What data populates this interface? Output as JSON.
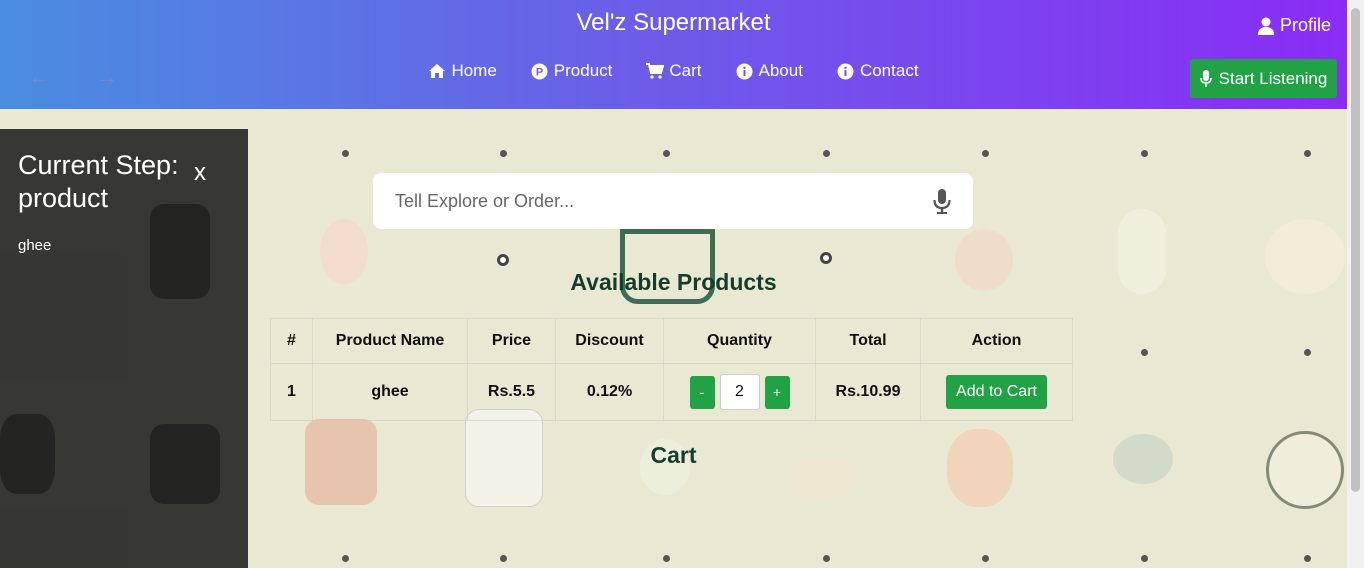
{
  "header": {
    "brand": "Vel'z Supermarket",
    "profile_label": "Profile",
    "listen_label": "Start Listening"
  },
  "nav": [
    {
      "label": "Home",
      "icon": "home-icon"
    },
    {
      "label": "Product",
      "icon": "product-icon"
    },
    {
      "label": "Cart",
      "icon": "cart-icon"
    },
    {
      "label": "About",
      "icon": "info-icon"
    },
    {
      "label": "Contact",
      "icon": "info-icon"
    }
  ],
  "side_panel": {
    "title": "Current Step: product",
    "close": "x",
    "value": "ghee"
  },
  "search": {
    "placeholder": "Tell Explore or Order..."
  },
  "products": {
    "title": "Available Products",
    "columns": [
      "#",
      "Product Name",
      "Price",
      "Discount",
      "Quantity",
      "Total",
      "Action"
    ],
    "rows": [
      {
        "index": "1",
        "name": "ghee",
        "price": "Rs.5.5",
        "discount": "0.12%",
        "qty": "2",
        "total": "Rs.10.99",
        "action": "Add to Cart",
        "minus": "-",
        "plus": "+"
      }
    ]
  },
  "cart": {
    "title": "Cart"
  },
  "colors": {
    "accent_green": "#21a345",
    "header_start": "#4a8de0",
    "header_end": "#8a2cf5",
    "heading": "#163d2a"
  }
}
